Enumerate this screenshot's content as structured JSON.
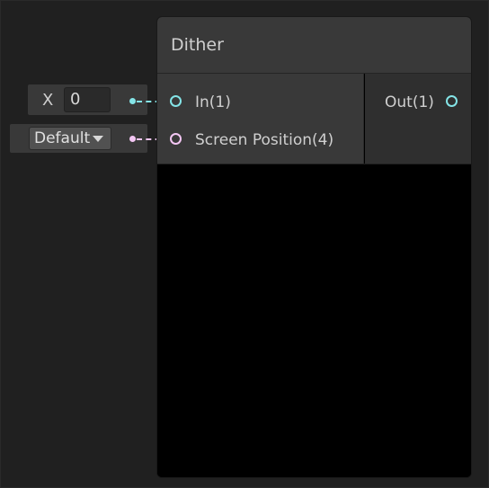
{
  "node": {
    "title": "Dither",
    "inputs": [
      {
        "label": "In(1)",
        "color": "#84e4e7"
      },
      {
        "label": "Screen Position(4)",
        "color": "#f3c6f3"
      }
    ],
    "outputs": [
      {
        "label": "Out(1)",
        "color": "#84e4e7"
      }
    ]
  },
  "controls": {
    "x_label": "X",
    "x_value": "0",
    "dropdown_value": "Default"
  },
  "colors": {
    "float_port": "#84e4e7",
    "vector4_port": "#f3c6f3",
    "node_header": "#393939",
    "preview": "#000000"
  }
}
